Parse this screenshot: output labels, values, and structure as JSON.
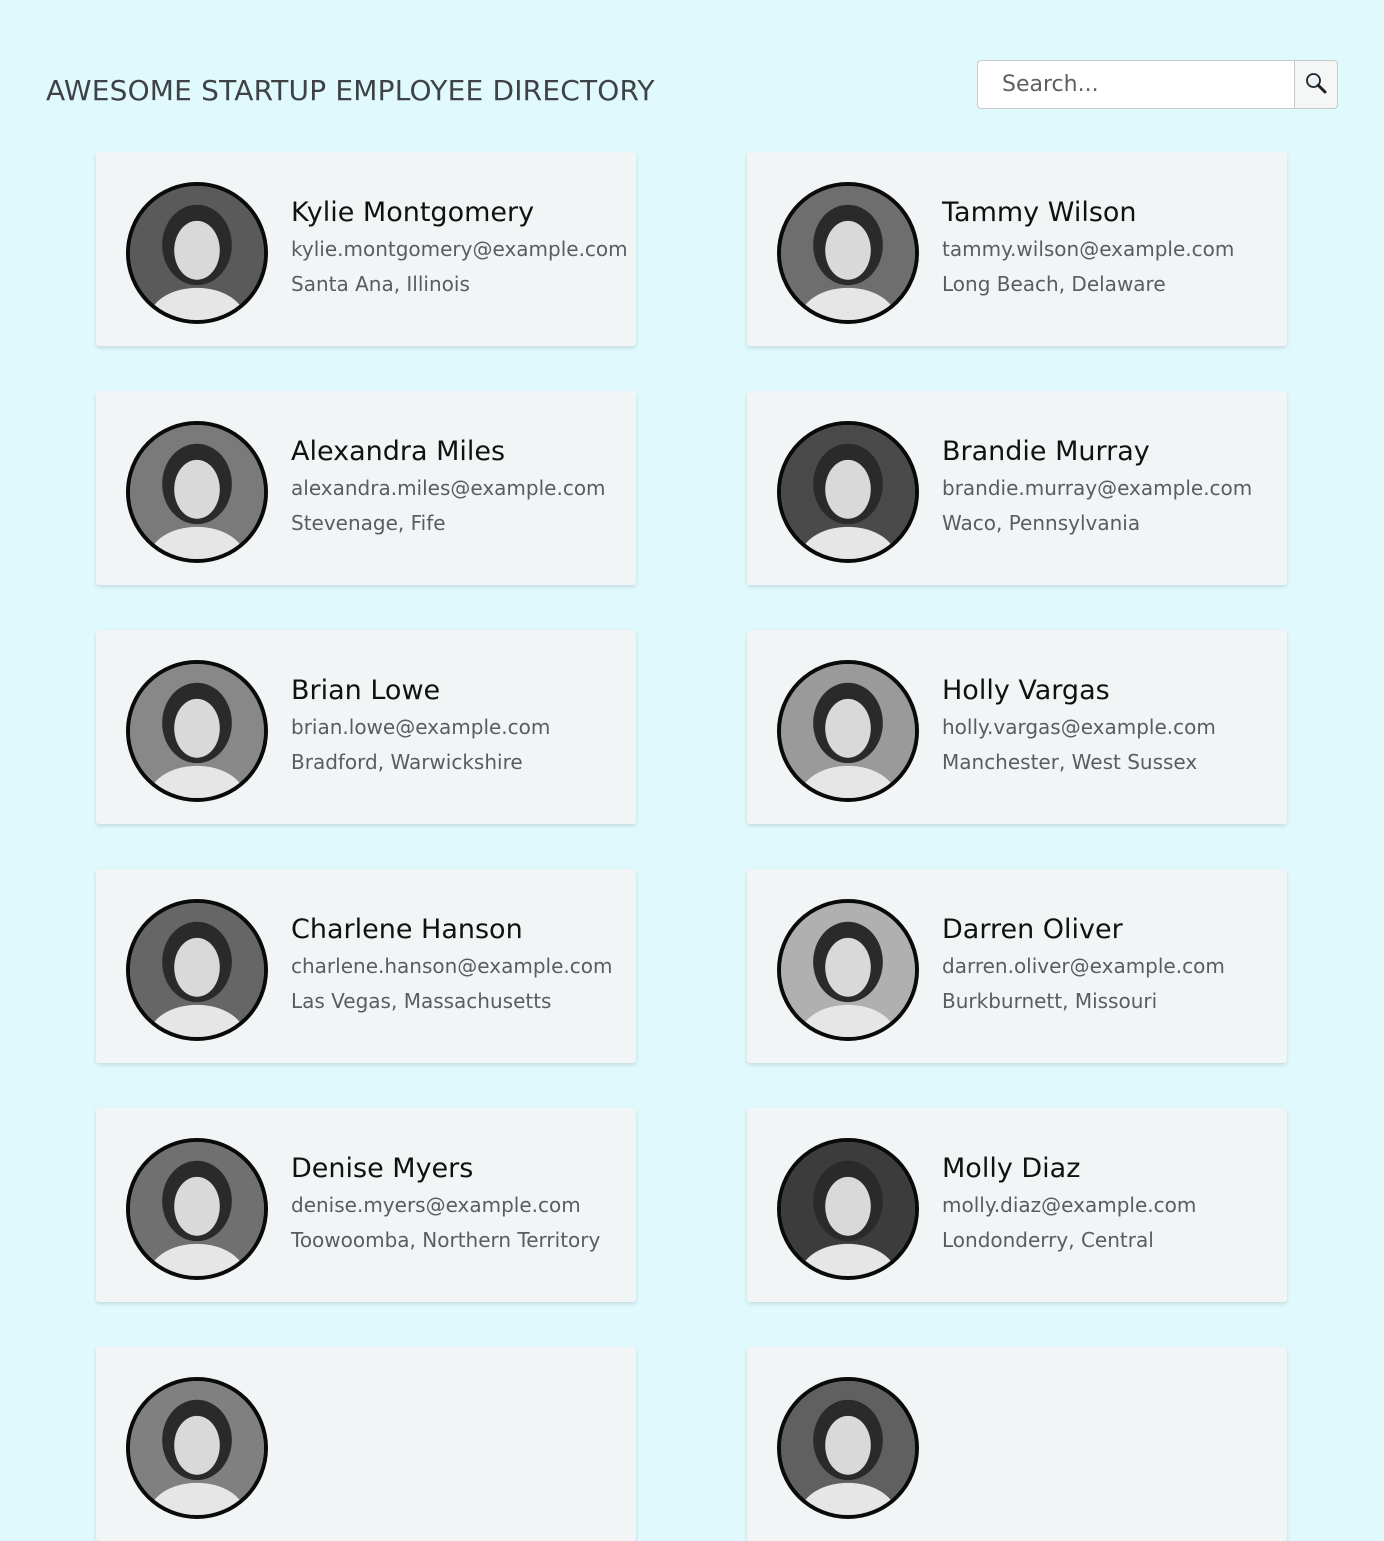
{
  "header": {
    "title": "AWESOME STARTUP EMPLOYEE DIRECTORY",
    "search_placeholder": "Search...",
    "search_icon": "magnifier-icon"
  },
  "employees": [
    {
      "name": "Kylie Montgomery",
      "email": "kylie.montgomery@example.com",
      "location": "Santa Ana, Illinois"
    },
    {
      "name": "Tammy Wilson",
      "email": "tammy.wilson@example.com",
      "location": "Long Beach, Delaware"
    },
    {
      "name": "Alexandra Miles",
      "email": "alexandra.miles@example.com",
      "location": "Stevenage, Fife"
    },
    {
      "name": "Brandie Murray",
      "email": "brandie.murray@example.com",
      "location": "Waco, Pennsylvania"
    },
    {
      "name": "Brian Lowe",
      "email": "brian.lowe@example.com",
      "location": "Bradford, Warwickshire"
    },
    {
      "name": "Holly Vargas",
      "email": "holly.vargas@example.com",
      "location": "Manchester, West Sussex"
    },
    {
      "name": "Charlene Hanson",
      "email": "charlene.hanson@example.com",
      "location": "Las Vegas, Massachusetts"
    },
    {
      "name": "Darren Oliver",
      "email": "darren.oliver@example.com",
      "location": "Burkburnett, Missouri"
    },
    {
      "name": "Denise Myers",
      "email": "denise.myers@example.com",
      "location": "Toowoomba, Northern Territory"
    },
    {
      "name": "Molly Diaz",
      "email": "molly.diaz@example.com",
      "location": "Londonderry, Central"
    },
    {
      "name": "",
      "email": "",
      "location": ""
    },
    {
      "name": "",
      "email": "",
      "location": ""
    }
  ],
  "colors": {
    "background": "#dff9fd",
    "card": "#f1f5f6",
    "avatar_border": "#0a0a0a"
  }
}
